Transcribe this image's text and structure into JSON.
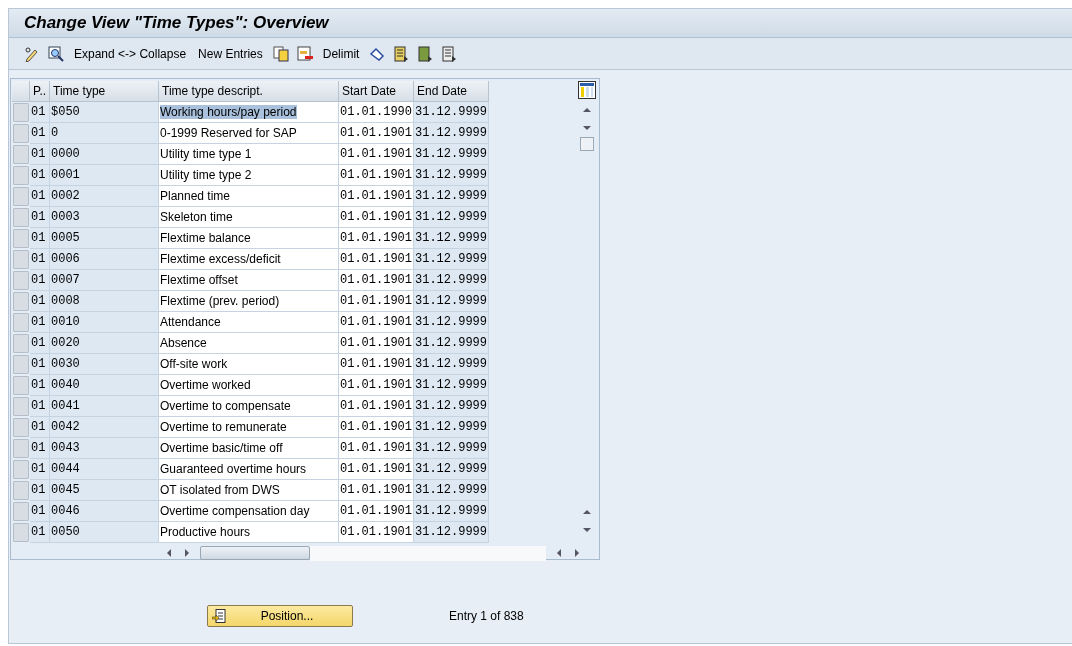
{
  "window": {
    "title": "Change View \"Time Types\": Overview"
  },
  "toolbar": {
    "buttons": [
      {
        "label": "Expand <-> Collapse"
      },
      {
        "label": "New Entries"
      },
      {
        "label": "Delimit"
      }
    ]
  },
  "table": {
    "columns": [
      "P..",
      "Time type",
      "Time type descript.",
      "Start Date",
      "End Date"
    ],
    "rows": [
      {
        "cells": [
          "01",
          "$050",
          "Working hours/pay period",
          "01.01.1990",
          "31.12.9999"
        ],
        "highlighted": true
      },
      {
        "cells": [
          "01",
          "0",
          "0-1999 Reserved for SAP",
          "01.01.1901",
          "31.12.9999"
        ],
        "highlighted": false
      },
      {
        "cells": [
          "01",
          "0000",
          "Utility time type 1",
          "01.01.1901",
          "31.12.9999"
        ],
        "highlighted": false
      },
      {
        "cells": [
          "01",
          "0001",
          "Utility time type 2",
          "01.01.1901",
          "31.12.9999"
        ],
        "highlighted": false
      },
      {
        "cells": [
          "01",
          "0002",
          "Planned time",
          "01.01.1901",
          "31.12.9999"
        ],
        "highlighted": false
      },
      {
        "cells": [
          "01",
          "0003",
          "Skeleton time",
          "01.01.1901",
          "31.12.9999"
        ],
        "highlighted": false
      },
      {
        "cells": [
          "01",
          "0005",
          "Flextime balance",
          "01.01.1901",
          "31.12.9999"
        ],
        "highlighted": false
      },
      {
        "cells": [
          "01",
          "0006",
          "Flextime excess/deficit",
          "01.01.1901",
          "31.12.9999"
        ],
        "highlighted": false
      },
      {
        "cells": [
          "01",
          "0007",
          "Flextime offset",
          "01.01.1901",
          "31.12.9999"
        ],
        "highlighted": false
      },
      {
        "cells": [
          "01",
          "0008",
          "Flextime (prev. period)",
          "01.01.1901",
          "31.12.9999"
        ],
        "highlighted": false
      },
      {
        "cells": [
          "01",
          "0010",
          "Attendance",
          "01.01.1901",
          "31.12.9999"
        ],
        "highlighted": false
      },
      {
        "cells": [
          "01",
          "0020",
          "Absence",
          "01.01.1901",
          "31.12.9999"
        ],
        "highlighted": false
      },
      {
        "cells": [
          "01",
          "0030",
          "Off-site work",
          "01.01.1901",
          "31.12.9999"
        ],
        "highlighted": false
      },
      {
        "cells": [
          "01",
          "0040",
          "Overtime worked",
          "01.01.1901",
          "31.12.9999"
        ],
        "highlighted": false
      },
      {
        "cells": [
          "01",
          "0041",
          "Overtime to compensate",
          "01.01.1901",
          "31.12.9999"
        ],
        "highlighted": false
      },
      {
        "cells": [
          "01",
          "0042",
          "Overtime to remunerate",
          "01.01.1901",
          "31.12.9999"
        ],
        "highlighted": false
      },
      {
        "cells": [
          "01",
          "0043",
          "Overtime basic/time off",
          "01.01.1901",
          "31.12.9999"
        ],
        "highlighted": false
      },
      {
        "cells": [
          "01",
          "0044",
          "Guaranteed overtime hours",
          "01.01.1901",
          "31.12.9999"
        ],
        "highlighted": false
      },
      {
        "cells": [
          "01",
          "0045",
          "OT isolated from DWS",
          "01.01.1901",
          "31.12.9999"
        ],
        "highlighted": false
      },
      {
        "cells": [
          "01",
          "0046",
          "Overtime compensation day",
          "01.01.1901",
          "31.12.9999"
        ],
        "highlighted": false
      },
      {
        "cells": [
          "01",
          "0050",
          "Productive hours",
          "01.01.1901",
          "31.12.9999"
        ],
        "highlighted": false
      }
    ]
  },
  "footer": {
    "position_button": "Position...",
    "entry_info": "Entry 1 of 838"
  }
}
